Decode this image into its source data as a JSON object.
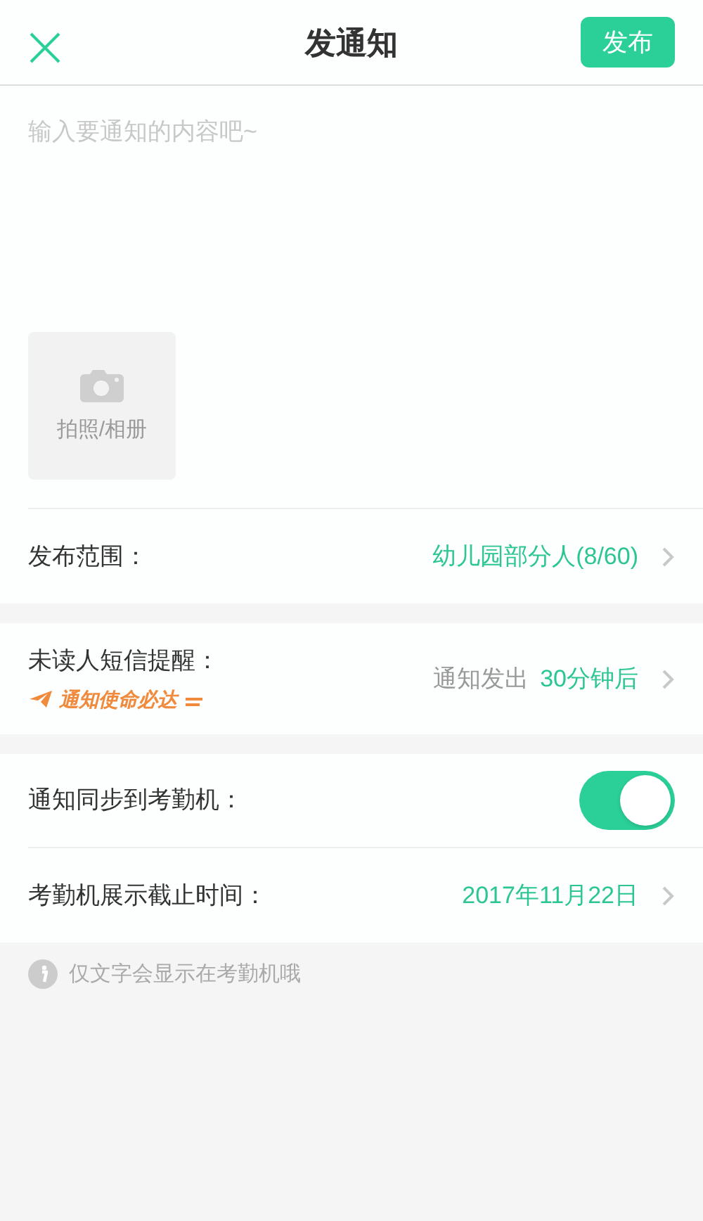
{
  "header": {
    "title": "发通知",
    "publish_button": "发布"
  },
  "content": {
    "placeholder": "输入要通知的内容吧~"
  },
  "photo_button": {
    "label": "拍照/相册"
  },
  "sections": [
    {
      "rows": [
        {
          "kind": "link",
          "label": "发布范围：",
          "value": "幼儿园部分人(8/60)"
        }
      ]
    },
    {
      "rows": [
        {
          "kind": "reminder",
          "label": "未读人短信提醒：",
          "tag": "通知使命必达",
          "prefix": "通知发出",
          "value": "30分钟后"
        }
      ]
    },
    {
      "rows": [
        {
          "kind": "toggle",
          "label": "通知同步到考勤机：",
          "on": true
        },
        {
          "kind": "link",
          "label": "考勤机展示截止时间：",
          "value": "2017年11月22日"
        }
      ]
    }
  ],
  "note": "仅文字会显示在考勤机哦"
}
